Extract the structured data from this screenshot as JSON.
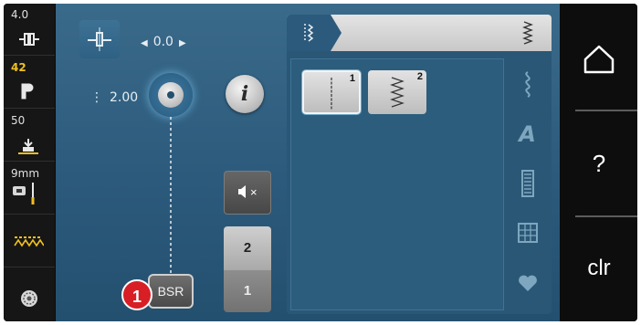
{
  "left_toolbar": {
    "items": [
      {
        "value": "4.0",
        "icon": "stitch-width-icon"
      },
      {
        "value": "42",
        "icon": "presser-foot-icon"
      },
      {
        "value": "50",
        "icon": "presser-foot-pressure-icon"
      },
      {
        "value": "9mm",
        "icon": "needle-plate-icon"
      },
      {
        "value": "",
        "icon": "stitch-pattern-icon"
      },
      {
        "value": "",
        "icon": "bobbin-icon"
      }
    ]
  },
  "stitch_controls": {
    "position_value": "0.0",
    "length_value": "2.00"
  },
  "buttons": {
    "info_label": "i",
    "mute_label": "×",
    "counter_top": "2",
    "counter_bottom": "1",
    "bsr_label": "BSR",
    "callout_badge": "1"
  },
  "stitch_panel": {
    "stitches": [
      {
        "number": "1",
        "type": "straight-stitch",
        "selected": true
      },
      {
        "number": "2",
        "type": "zigzag-stitch",
        "selected": false
      }
    ],
    "categories": [
      "practical-stitch-icon",
      "alphabet-icon",
      "buttonhole-icon",
      "quilt-stitch-icon",
      "favorites-icon"
    ],
    "category_letter": "A"
  },
  "right_sidebar": {
    "help_label": "?",
    "clear_label": "clr"
  },
  "colors": {
    "screen_blue": "#2c5a7c",
    "accent_yellow": "#f0c020",
    "badge_red": "#d81f26"
  }
}
